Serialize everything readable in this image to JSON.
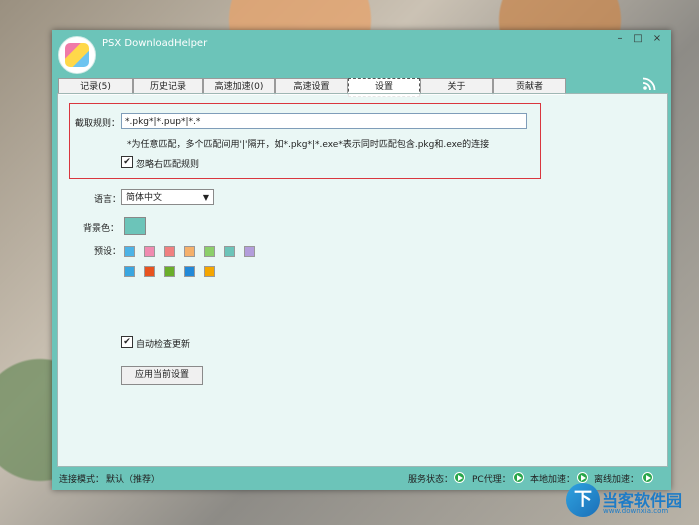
{
  "app": {
    "title": "PSX DownloadHelper"
  },
  "window_controls": {
    "minimize": "–",
    "maximize": "□",
    "close": "×"
  },
  "tabs": [
    {
      "label": "记录(5)"
    },
    {
      "label": "历史记录"
    },
    {
      "label": "高速加速(0)"
    },
    {
      "label": "高速设置"
    },
    {
      "label": "设置"
    },
    {
      "label": "关于"
    },
    {
      "label": "贡献者"
    }
  ],
  "settings": {
    "filter_label": "截取规则：",
    "filter_value": "*.pkg*|*.pup*|*.*",
    "filter_hint": "*为任意匹配，多个匹配间用'|'隔开，如*.pkg*|*.exe*表示同时匹配包含.pkg和.exe的连接",
    "ignore_right_label": "忽略右匹配规则",
    "ignore_right_checked": "✔",
    "language_label": "语言：",
    "language_value": "简体中文",
    "bg_label": "背景色：",
    "bg_color": "#6cc4b9",
    "preset_label": "预设：",
    "preset_row1": [
      "#4db3e6",
      "#f08bb0",
      "#f08080",
      "#f5b06b",
      "#8ccf6a",
      "#6cc4b9",
      "#b39ddb"
    ],
    "preset_row2": [
      "#3aa6e0",
      "#e8531f",
      "#6aae2a",
      "#2289d8",
      "#f5a600"
    ],
    "auto_update_label": "自动检查更新",
    "auto_update_checked": "✔",
    "apply_button": "应用当前设置"
  },
  "status": {
    "mode_label": "连接模式：",
    "mode_value": "默认（推荐）",
    "service": "服务状态：",
    "pc_proxy": "PC代理：",
    "local_accel": "本地加速：",
    "offline_accel": "离线加速："
  },
  "watermark": {
    "text": "当客软件园",
    "url": "www.downxia.com",
    "letter": "下"
  }
}
